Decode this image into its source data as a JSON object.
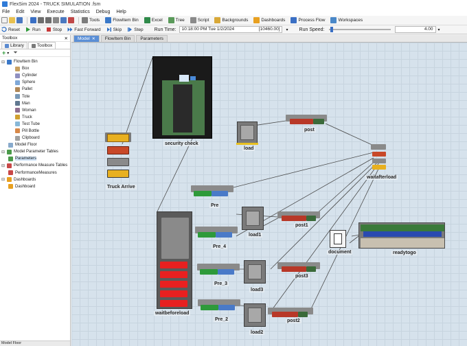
{
  "window": {
    "title": "FlexSim 2024 - TRUCK SIMULATION .fsm"
  },
  "menu": [
    "File",
    "Edit",
    "View",
    "Execute",
    "Statistics",
    "Debug",
    "Help"
  ],
  "toolbar": {
    "items": [
      "Tools",
      "FlowItem Bin",
      "Excel",
      "Tree",
      "Script",
      "Backgrounds",
      "Dashboards",
      "Process Flow",
      "Workspaces"
    ]
  },
  "run": {
    "reset": "Reset",
    "run": "Run",
    "stop": "Stop",
    "fast_forward": "Fast Forward",
    "skip": "Skip",
    "step": "Step",
    "run_time_label": "Run Time:",
    "run_time_value": "10:18:00 PM Tue 1/2/2024",
    "run_time_seconds": "[10460.00]",
    "speed_label": "Run Speed:",
    "speed_value": "4.00",
    "speed_fraction": 0.03
  },
  "toolbox": {
    "title": "Toolbox",
    "tabs": [
      "Library",
      "Toolbox"
    ],
    "tree": [
      {
        "label": "FlowItem Bin",
        "level": 0,
        "icon": "flowitem-bin-icon",
        "color": "#3a78c8",
        "expander": "⊟"
      },
      {
        "label": "Box",
        "level": 2,
        "icon": "box-icon",
        "color": "#c8a060"
      },
      {
        "label": "Cylinder",
        "level": 2,
        "icon": "cylinder-icon",
        "color": "#9090c0"
      },
      {
        "label": "Sphere",
        "level": 2,
        "icon": "sphere-icon",
        "color": "#7fa8d8"
      },
      {
        "label": "Pallet",
        "level": 2,
        "icon": "pallet-icon",
        "color": "#b08858"
      },
      {
        "label": "Tote",
        "level": 2,
        "icon": "tote-icon",
        "color": "#7a9ab8"
      },
      {
        "label": "Man",
        "level": 2,
        "icon": "man-icon",
        "color": "#607890"
      },
      {
        "label": "Woman",
        "level": 2,
        "icon": "woman-icon",
        "color": "#907090"
      },
      {
        "label": "Truck",
        "level": 2,
        "icon": "truck-icon",
        "color": "#d0a030"
      },
      {
        "label": "Test Tube",
        "level": 2,
        "icon": "test-tube-icon",
        "color": "#88b8d8"
      },
      {
        "label": "Pill Bottle",
        "level": 2,
        "icon": "pill-bottle-icon",
        "color": "#d88848"
      },
      {
        "label": "Clipboard",
        "level": 2,
        "icon": "clipboard-icon",
        "color": "#a0a0a0"
      },
      {
        "label": "Model Floor",
        "level": 1,
        "icon": "model-floor-icon",
        "color": "#88aacc"
      },
      {
        "label": "Model Parameter Tables",
        "level": 0,
        "icon": "table-icon",
        "color": "#4a9a4a",
        "expander": "⊟"
      },
      {
        "label": "Parameters",
        "level": 1,
        "icon": "table-icon",
        "color": "#4a9a4a",
        "selected": true
      },
      {
        "label": "Performance Measure Tables",
        "level": 0,
        "icon": "performance-icon",
        "color": "#c84848",
        "expander": "⊟"
      },
      {
        "label": "PerformanceMeasures",
        "level": 1,
        "icon": "performance-icon",
        "color": "#c84848"
      },
      {
        "label": "Dashboards",
        "level": 0,
        "icon": "dashboard-icon",
        "color": "#e8a020",
        "expander": "⊟"
      },
      {
        "label": "Dashboard",
        "level": 1,
        "icon": "dashboard-icon",
        "color": "#e8a020"
      }
    ],
    "footer": "Model Floor"
  },
  "doc_tabs": [
    "Model",
    "FlowItem Bin",
    "Parameters"
  ],
  "model_objects": {
    "truck_arrive": "Truck Arrive",
    "security_check": "security check",
    "load": "load",
    "post": "post",
    "waitafterload": "waitafterload",
    "pre": "Pre",
    "load1": "load1",
    "post1": "post1",
    "document": "document",
    "readytogo": "readytogo",
    "pre_4": "Pre_4",
    "pre_3": "Pre_3",
    "load3": "load3",
    "post3": "post3",
    "waitbeforeload": "waitbeforeload",
    "pre_2": "Pre_2",
    "load2": "load2",
    "post2": "post2"
  },
  "colors": {
    "accent": "#5b8fd6",
    "canvas": "#d6e2ec"
  }
}
